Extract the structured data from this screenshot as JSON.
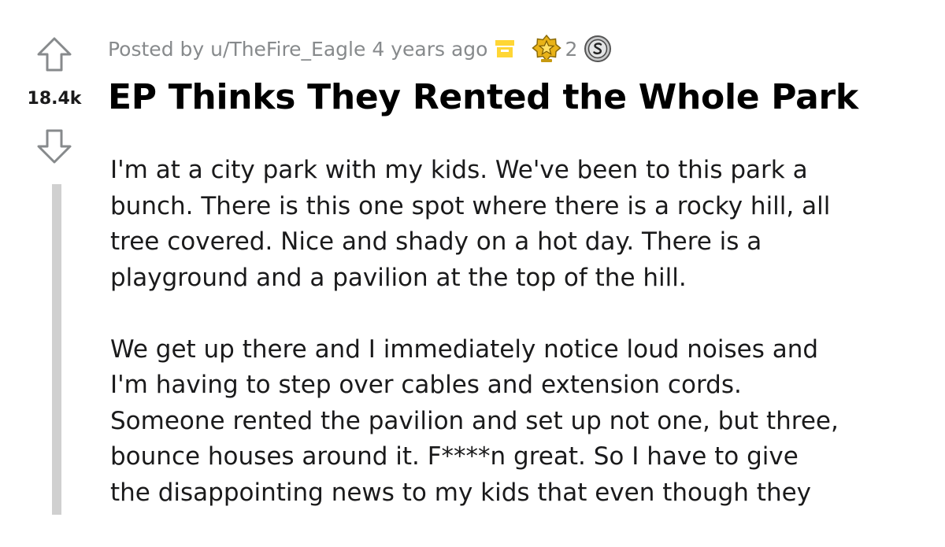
{
  "post": {
    "score": "18.4k",
    "meta": {
      "posted_by_prefix": "Posted by",
      "author": "u/TheFire_Eagle",
      "age": "4 years ago",
      "award_count": "2"
    },
    "title": "EP Thinks They Rented the Whole Park",
    "paragraphs": [
      "I'm at a city park with my kids. We've been to this park a\nbunch. There is this one spot where there is a rocky hill, all\ntree covered. Nice and shady on a hot day. There is a\nplayground and a pavilion at the top of the hill.",
      "We get up there and I immediately notice loud noises and\nI'm having to step over cables and extension cords.\nSomeone rented the pavilion and set up not one, but three,\nbounce houses around it. F****n great. So I have to give\nthe disappointing news to my kids that even though they"
    ]
  },
  "icons": {
    "upvote": "upvote-arrow-icon",
    "downvote": "downvote-arrow-icon",
    "archived": "archive-box-icon",
    "award_gold": "gold-star-award-icon",
    "award_silver": "silver-coin-award-icon"
  },
  "colors": {
    "text": "#1a1a1b",
    "meta": "#878a8c",
    "archive": "#ffd635",
    "award_gold": "#f5c518",
    "thread_line": "#d0d0d0"
  }
}
